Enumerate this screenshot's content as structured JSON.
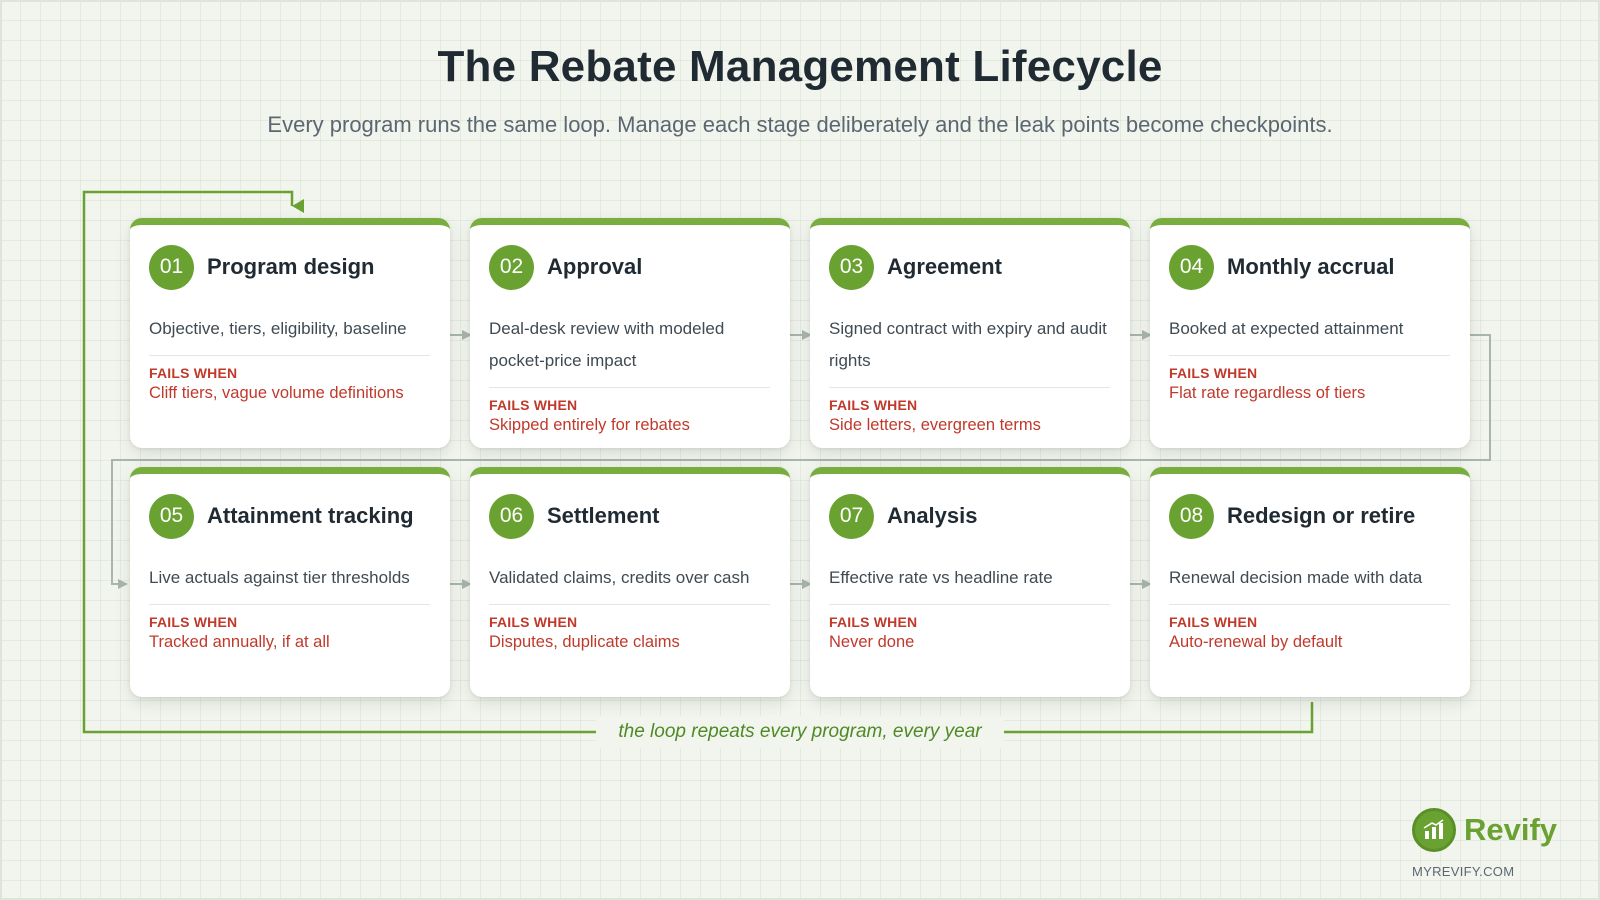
{
  "title": "The Rebate Management Lifecycle",
  "subtitle": "Every program runs the same loop. Manage each stage deliberately and the leak points become checkpoints.",
  "fails_label": "FAILS WHEN",
  "stages": [
    {
      "num": "01",
      "title": "Program design",
      "desc": "Objective, tiers, eligibility, baseline",
      "fails": "Cliff tiers, vague volume definitions"
    },
    {
      "num": "02",
      "title": "Approval",
      "desc": "Deal-desk review with modeled pocket-price impact",
      "fails": "Skipped entirely for rebates"
    },
    {
      "num": "03",
      "title": "Agreement",
      "desc": "Signed contract with expiry and audit rights",
      "fails": "Side letters, evergreen terms"
    },
    {
      "num": "04",
      "title": "Monthly accrual",
      "desc": "Booked at expected attainment",
      "fails": "Flat rate regardless of tiers"
    },
    {
      "num": "05",
      "title": "Attainment tracking",
      "desc": "Live actuals against tier thresholds",
      "fails": "Tracked annually, if at all"
    },
    {
      "num": "06",
      "title": "Settlement",
      "desc": "Validated claims, credits over cash",
      "fails": "Disputes, duplicate claims"
    },
    {
      "num": "07",
      "title": "Analysis",
      "desc": "Effective rate vs headline rate",
      "fails": "Never done"
    },
    {
      "num": "08",
      "title": "Redesign or retire",
      "desc": "Renewal decision made with data",
      "fails": "Auto-renewal by default"
    }
  ],
  "loop_label": "the loop repeats every program, every year",
  "brand": {
    "name": "Revify",
    "url": "MYREVIFY.COM",
    "icon": "bar-chart-growth-icon"
  },
  "colors": {
    "accent": "#6aa232",
    "fail": "#c0392b",
    "connector": "#a9b5ad"
  }
}
